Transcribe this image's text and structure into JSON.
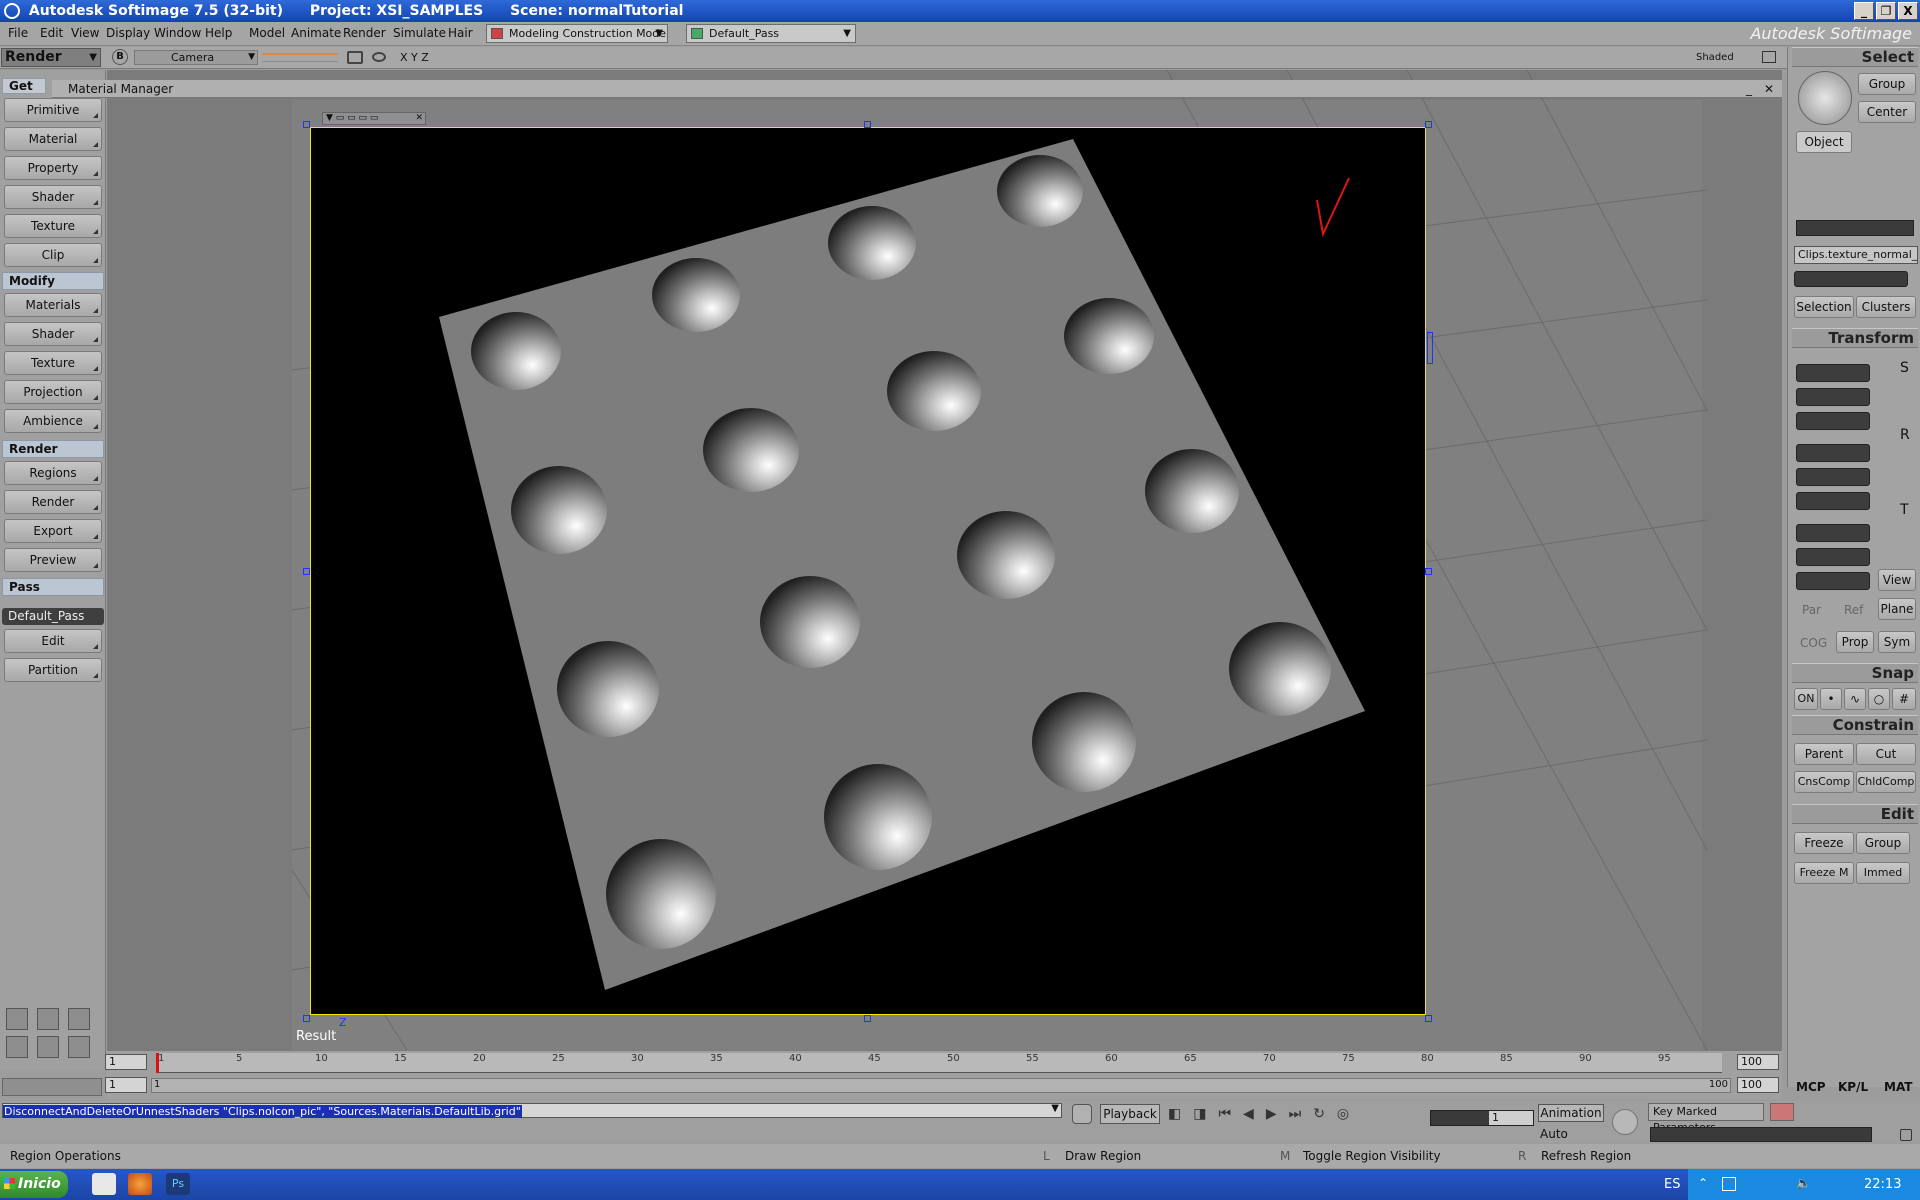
{
  "window": {
    "app_title": "Autodesk Softimage 7.5 (32-bit)",
    "project": "Project: XSI_SAMPLES",
    "scene": "Scene: normalTutorial",
    "brand": "Autodesk Softimage",
    "min": "_",
    "max": "❐",
    "close": "X"
  },
  "menu": {
    "file": "File",
    "edit": "Edit",
    "view": "View",
    "display": "Display",
    "window": "Window",
    "help": "Help",
    "model": "Model",
    "animate": "Animate",
    "render": "Render",
    "simulate": "Simulate",
    "hair": "Hair",
    "construction_mode": "Modeling Construction Mode",
    "pass": "Default_Pass"
  },
  "toolbar": {
    "module": "Render",
    "b_label": "B",
    "camera": "Camera",
    "axes": "X Y Z",
    "shading": "Shaded"
  },
  "left": {
    "get": "Get",
    "primitive": "Primitive",
    "material": "Material",
    "property": "Property",
    "shader": "Shader",
    "texture": "Texture",
    "clip": "Clip",
    "modify": "Modify",
    "materials": "Materials",
    "m_shader": "Shader",
    "m_texture": "Texture",
    "projection": "Projection",
    "ambience": "Ambience",
    "render": "Render",
    "regions": "Regions",
    "r_render": "Render",
    "export": "Export",
    "preview": "Preview",
    "pass": "Pass",
    "pass_value": "Default_Pass",
    "p_edit": "Edit",
    "partition": "Partition"
  },
  "viewport": {
    "material_manager": "Material Manager",
    "result_label": "Result",
    "axis_z": "Z"
  },
  "right": {
    "select": "Select",
    "group": "Group",
    "center": "Center",
    "object": "Object",
    "clip_field": "Clips.texture_normal_t",
    "selection": "Selection",
    "clusters": "Clusters",
    "transform": "Transform",
    "s": "S",
    "r": "R",
    "t": "T",
    "view": "View",
    "par": "Par",
    "ref": "Ref",
    "plane": "Plane",
    "cog": "COG",
    "prop": "Prop",
    "sym": "Sym",
    "snap": "Snap",
    "on": "ON",
    "constrain": "Constrain",
    "parent": "Parent",
    "cut": "Cut",
    "cnscomp": "CnsComp",
    "chldcomp": "ChldComp",
    "edit": "Edit",
    "freeze": "Freeze",
    "e_group": "Group",
    "freeze_m": "Freeze M",
    "immed": "Immed",
    "mcp": "MCP",
    "kpl": "KP/L",
    "mat": "MAT"
  },
  "timeline": {
    "start": "1",
    "end": "100",
    "ticks": [
      "1",
      "5",
      "10",
      "15",
      "20",
      "25",
      "30",
      "35",
      "40",
      "45",
      "50",
      "55",
      "60",
      "65",
      "70",
      "75",
      "80",
      "85",
      "90",
      "95"
    ],
    "range_start": "1",
    "range_in": "1",
    "range_out": "100",
    "range_end": "100"
  },
  "command": {
    "text": "DisconnectAndDeleteOrUnnestShaders \"Clips.noIcon_pic\", \"Sources.Materials.DefaultLib.grid\"",
    "playback": "Playback",
    "frame": "1",
    "animation": "Animation",
    "auto": "Auto",
    "key_marked": "Key Marked Parameters"
  },
  "status": {
    "left": "Region Operations",
    "l_key": "L",
    "l_action": "Draw Region",
    "m_key": "M",
    "m_action": "Toggle Region Visibility",
    "r_key": "R",
    "r_action": "Refresh Region"
  },
  "taskbar": {
    "start": "Inicio",
    "lang": "ES",
    "time": "22:13"
  },
  "colors": {
    "render_bg": "#000000",
    "plane": "#7d7d7d",
    "frame_border": "#f3e600",
    "handle": "#1a37ff",
    "check_mark": "#e11515"
  }
}
